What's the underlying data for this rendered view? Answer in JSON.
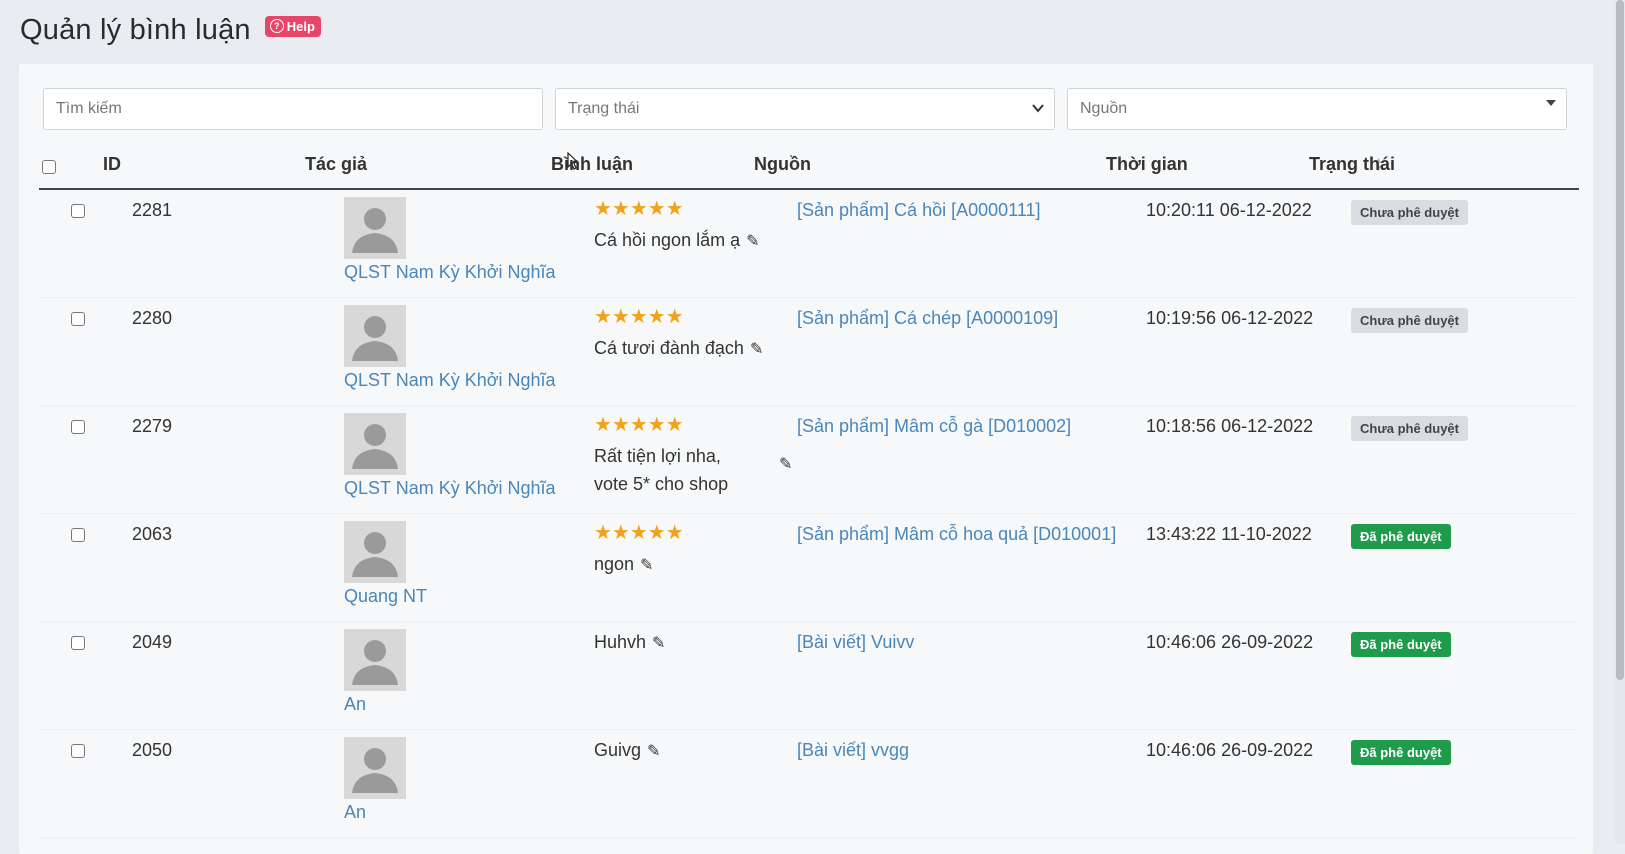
{
  "header": {
    "title": "Quản lý bình luận",
    "help_label": "Help"
  },
  "filters": {
    "search_placeholder": "Tìm kiếm",
    "status_label": "Trạng thái",
    "source_label": "Nguồn"
  },
  "table": {
    "columns": [
      "ID",
      "Tác giả",
      "Bình luận",
      "Nguồn",
      "Thời gian",
      "Trạng thái"
    ],
    "rows": [
      {
        "id": "2281",
        "author": "QLST Nam Kỳ Khởi Nghĩa",
        "stars": "★★★★★",
        "comment": "Cá hồi ngon lắm ạ",
        "source": "[Sản phẩm] Cá hồi [A0000111]",
        "time": "10:20:11 06-12-2022",
        "status": "Chưa phê duyệt"
      },
      {
        "id": "2280",
        "author": "QLST Nam Kỳ Khởi Nghĩa",
        "stars": "★★★★★",
        "comment": "Cá tươi đành đạch",
        "source": "[Sản phẩm] Cá chép [A0000109]",
        "time": "10:19:56 06-12-2022",
        "status": "Chưa phê duyệt"
      },
      {
        "id": "2279",
        "author": "QLST Nam Kỳ Khởi Nghĩa",
        "stars": "★★★★★",
        "comment_line1": "Rất tiện lợi nha,",
        "comment_line2": "vote 5* cho shop",
        "source": "[Sản phẩm] Mâm cỗ gà [D010002]",
        "time": "10:18:56 06-12-2022",
        "status": "Chưa phê duyệt"
      },
      {
        "id": "2063",
        "author": "Quang NT",
        "stars": "★★★★★",
        "comment": "ngon",
        "source": "[Sản phẩm] Mâm cỗ hoa quả [D010001]",
        "time": "13:43:22 11-10-2022",
        "status": "Đã phê duyệt"
      },
      {
        "id": "2049",
        "author": "An",
        "comment": "Huhvh",
        "source": "[Bài viết] Vuivv",
        "time": "10:46:06 26-09-2022",
        "status": "Đã phê duyệt"
      },
      {
        "id": "2050",
        "author": "An",
        "comment": "Guivg",
        "source": "[Bài viết] vvgg",
        "time": "10:46:06 26-09-2022",
        "status": "Đã phê duyệt"
      }
    ]
  },
  "icons": {
    "edit": "pencil-icon",
    "avatar": "user-avatar-icon",
    "sort": "sort-icon"
  },
  "colors": {
    "help": "#e8456a",
    "link": "#4a86b8",
    "stars": "#f0a31a",
    "approved": "#1e9b4b",
    "pending": "#d9dde2"
  }
}
